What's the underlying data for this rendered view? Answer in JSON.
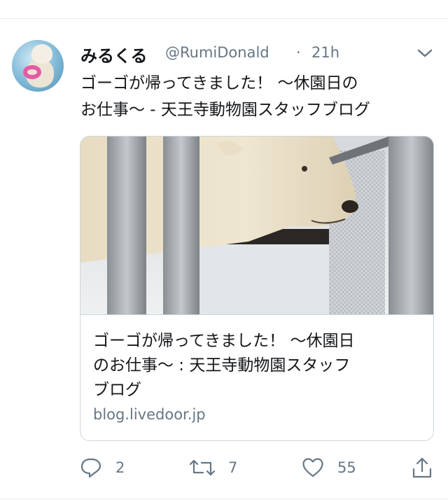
{
  "tweet": {
    "author_name": "みるくる",
    "handle": "@RumiDonald",
    "separator": "·",
    "time": "21h",
    "text": "ゴーゴが帰ってきました！ 〜休園日の\nお仕事〜 - 天王寺動物園スタッフブログ"
  },
  "card": {
    "title": "ゴーゴが帰ってきました！ 〜休園日\nのお仕事〜 : 天王寺動物園スタッフ\nブログ",
    "domain": "blog.livedoor.jp"
  },
  "actions": {
    "reply_count": "2",
    "retweet_count": "7",
    "like_count": "55"
  },
  "icons": {
    "reply": "reply-icon",
    "retweet": "retweet-icon",
    "like": "heart-icon",
    "share": "share-icon",
    "menu": "chevron-down-icon"
  },
  "colors": {
    "text": "#14171a",
    "secondary": "#657786",
    "border": "#ccd6dd"
  }
}
